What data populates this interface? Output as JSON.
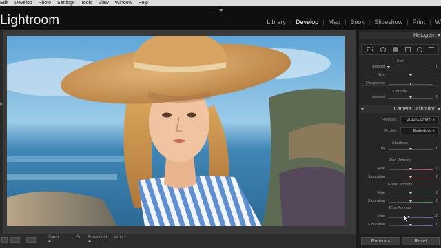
{
  "menu": [
    "Edit",
    "Develop",
    "Photo",
    "Settings",
    "Tools",
    "View",
    "Window",
    "Help"
  ],
  "app": {
    "title": "Lightroom"
  },
  "modules": [
    {
      "label": "Library",
      "active": false
    },
    {
      "label": "Develop",
      "active": true
    },
    {
      "label": "Map",
      "active": false
    },
    {
      "label": "Book",
      "active": false
    },
    {
      "label": "Slideshow",
      "active": false
    },
    {
      "label": "Print",
      "active": false
    },
    {
      "label": "W",
      "active": false
    }
  ],
  "toolbar": {
    "zoom_label": "Zoom",
    "fit_label": "Fit",
    "grid_label": "Show Grid:",
    "grid_value": "Auto ÷"
  },
  "panel": {
    "histogram": "Histogram",
    "grain": {
      "title": "Grain",
      "rows": [
        {
          "label": "Amount",
          "value": "0",
          "pos": 0.0
        },
        {
          "label": "Size",
          "value": "",
          "pos": 0.5
        },
        {
          "label": "Roughness",
          "value": "",
          "pos": 0.5
        }
      ]
    },
    "dehaze": {
      "title": "Dehaze",
      "rows": [
        {
          "label": "Amount",
          "value": "0",
          "pos": 0.5
        }
      ]
    },
    "calibration": {
      "title": "Camera Calibration",
      "process_label": "Process :",
      "process_value": "2012 (Current) ÷",
      "profile_label": "Profile :",
      "profile_value": "Embedded ÷",
      "shadows": {
        "title": "Shadows",
        "rows": [
          {
            "label": "Tint",
            "value": "0",
            "pos": 0.5
          }
        ]
      },
      "red": {
        "title": "Red Primary",
        "rows": [
          {
            "label": "Hue",
            "value": "0",
            "pos": 0.5
          },
          {
            "label": "Saturation",
            "value": "0",
            "pos": 0.5
          }
        ]
      },
      "green": {
        "title": "Green Primary",
        "rows": [
          {
            "label": "Hue",
            "value": "0",
            "pos": 0.5
          },
          {
            "label": "Saturation",
            "value": "0",
            "pos": 0.5
          }
        ]
      },
      "blue": {
        "title": "Blue Primary",
        "rows": [
          {
            "label": "Hue",
            "value": "– 10",
            "pos": 0.45
          },
          {
            "label": "Saturation",
            "value": "0",
            "pos": 0.5
          }
        ]
      }
    },
    "previous_label": "Previous",
    "reset_label": "Reset"
  },
  "colors": {
    "accent": "#ffffff",
    "panel": "#262626",
    "header": "#0f0f0f"
  }
}
